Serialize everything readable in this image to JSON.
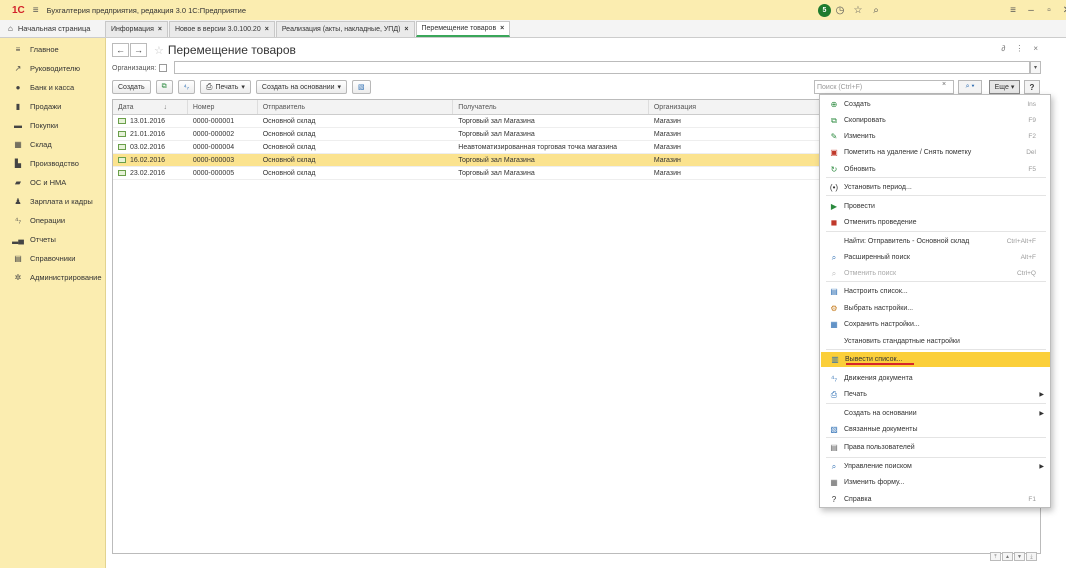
{
  "titlebar": {
    "logo": "1С",
    "menu_icon": "hamburger-icon",
    "title": "Бухгалтерия предприятия, редакция 3.0 1С:Предприятие",
    "notification_count": "5"
  },
  "tabs": {
    "home": "Начальная страница",
    "items": [
      {
        "label": "Информация"
      },
      {
        "label": "Новое в версии 3.0.100.20"
      },
      {
        "label": "Реализация (акты, накладные, УПД)"
      },
      {
        "label": "Перемещение товаров"
      }
    ]
  },
  "sidebar": {
    "items": [
      {
        "label": "Главное",
        "icon": "menu-lines-icon"
      },
      {
        "label": "Руководителю",
        "icon": "chart-line-icon"
      },
      {
        "label": "Банк и касса",
        "icon": "coin-icon"
      },
      {
        "label": "Продажи",
        "icon": "bag-icon"
      },
      {
        "label": "Покупки",
        "icon": "cart-icon"
      },
      {
        "label": "Склад",
        "icon": "warehouse-icon"
      },
      {
        "label": "Производство",
        "icon": "factory-icon"
      },
      {
        "label": "ОС и НМА",
        "icon": "truck-icon"
      },
      {
        "label": "Зарплата и кадры",
        "icon": "person-icon"
      },
      {
        "label": "Операции",
        "icon": "operations-icon"
      },
      {
        "label": "Отчеты",
        "icon": "bar-chart-icon"
      },
      {
        "label": "Справочники",
        "icon": "book-icon"
      },
      {
        "label": "Администрирование",
        "icon": "gear-icon"
      }
    ]
  },
  "page": {
    "title": "Перемещение товаров",
    "org_label": "Организация:",
    "buttons": {
      "create": "Создать",
      "print": "Печать",
      "create_based": "Создать на основании",
      "more": "Еще",
      "help": "?"
    },
    "search_placeholder": "Поиск (Ctrl+F)"
  },
  "table": {
    "columns": [
      "Дата",
      "Номер",
      "Отправитель",
      "Получатель",
      "Организация"
    ],
    "rows": [
      {
        "date": "13.01.2016",
        "number": "0000-000001",
        "sender": "Основной склад",
        "receiver": "Торговый зал Магазина",
        "org": "Магазин"
      },
      {
        "date": "21.01.2016",
        "number": "0000-000002",
        "sender": "Основной склад",
        "receiver": "Торговый зал Магазина",
        "org": "Магазин"
      },
      {
        "date": "03.02.2016",
        "number": "0000-000004",
        "sender": "Основной склад",
        "receiver": "Неавтоматизированная торговая точка магазина",
        "org": "Магазин"
      },
      {
        "date": "16.02.2016",
        "number": "0000-000003",
        "sender": "Основной склад",
        "receiver": "Торговый зал Магазина",
        "org": "Магазин"
      },
      {
        "date": "23.02.2016",
        "number": "0000-000005",
        "sender": "Основной склад",
        "receiver": "Торговый зал Магазина",
        "org": "Магазин"
      }
    ],
    "selected_row": 3
  },
  "menu": {
    "items": [
      {
        "label": "Создать",
        "shortcut": "Ins",
        "icon": "plus-circle-icon"
      },
      {
        "label": "Скопировать",
        "shortcut": "F9",
        "icon": "copy-icon"
      },
      {
        "label": "Изменить",
        "shortcut": "F2",
        "icon": "pencil-icon"
      },
      {
        "label": "Пометить на удаление / Снять пометку",
        "shortcut": "Del",
        "icon": "delete-mark-icon"
      },
      {
        "label": "Обновить",
        "shortcut": "F5",
        "icon": "refresh-icon"
      },
      {
        "label": "Установить период...",
        "shortcut": "",
        "icon": "period-icon"
      },
      {
        "label": "Провести",
        "shortcut": "",
        "icon": "post-icon"
      },
      {
        "label": "Отменить проведение",
        "shortcut": "",
        "icon": "unpost-icon"
      },
      {
        "label": "Найти: Отправитель - Основной склад",
        "shortcut": "Ctrl+Alt+F",
        "icon": ""
      },
      {
        "label": "Расширенный поиск",
        "shortcut": "Alt+F",
        "icon": "search-icon"
      },
      {
        "label": "Отменить поиск",
        "shortcut": "Ctrl+Q",
        "icon": "cancel-search-icon"
      },
      {
        "label": "Настроить список...",
        "shortcut": "",
        "icon": "list-settings-icon"
      },
      {
        "label": "Выбрать настройки...",
        "shortcut": "",
        "icon": "choose-settings-icon"
      },
      {
        "label": "Сохранить настройки...",
        "shortcut": "",
        "icon": "save-settings-icon"
      },
      {
        "label": "Установить стандартные настройки",
        "shortcut": "",
        "icon": ""
      },
      {
        "label": "Вывести список...",
        "shortcut": "",
        "icon": "output-list-icon"
      },
      {
        "label": "Движения документа",
        "shortcut": "",
        "icon": "movements-icon"
      },
      {
        "label": "Печать",
        "shortcut": "",
        "icon": "printer-icon"
      },
      {
        "label": "Создать на основании",
        "shortcut": "",
        "icon": ""
      },
      {
        "label": "Связанные документы",
        "shortcut": "",
        "icon": "linked-docs-icon"
      },
      {
        "label": "Права пользователей",
        "shortcut": "",
        "icon": "rights-icon"
      },
      {
        "label": "Управление поиском",
        "shortcut": "",
        "icon": "search-icon"
      },
      {
        "label": "Изменить форму...",
        "shortcut": "",
        "icon": "form-icon"
      },
      {
        "label": "Справка",
        "shortcut": "F1",
        "icon": "help-icon"
      }
    ]
  }
}
